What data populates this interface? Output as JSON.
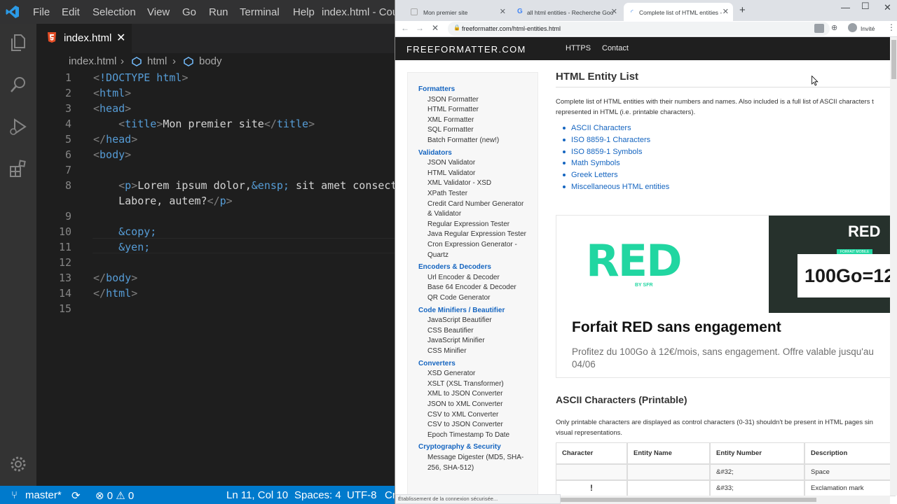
{
  "vscode": {
    "menu": [
      "File",
      "Edit",
      "Selection",
      "View",
      "Go",
      "Run",
      "Terminal",
      "Help"
    ],
    "window_title": "index.html - Cou",
    "tab_label": "index.html",
    "breadcrumb": [
      "index.html",
      "html",
      "body"
    ],
    "lines": [
      {
        "n": "1",
        "code": "<!DOCTYPE html>"
      },
      {
        "n": "2",
        "code": "<html>"
      },
      {
        "n": "3",
        "code": "<head>"
      },
      {
        "n": "4",
        "code": "    <title>Mon premier site</title>"
      },
      {
        "n": "5",
        "code": "</head>"
      },
      {
        "n": "6",
        "code": "<body>"
      },
      {
        "n": "7",
        "code": ""
      },
      {
        "n": "8",
        "code": "    <p>Lorem ipsum dolor,&ensp; sit amet consecte"
      },
      {
        "n": "",
        "code": "    Labore, autem?</p>"
      },
      {
        "n": "9",
        "code": ""
      },
      {
        "n": "10",
        "code": "    &copy;"
      },
      {
        "n": "11",
        "code": "    &yen;"
      },
      {
        "n": "12",
        "code": ""
      },
      {
        "n": "13",
        "code": "</body>"
      },
      {
        "n": "14",
        "code": "</html>"
      },
      {
        "n": "15",
        "code": ""
      }
    ],
    "status": {
      "branch": "master*",
      "problems": "⊗ 0 ⚠ 0",
      "position": "Ln 11, Col 10",
      "spaces": "Spaces: 4",
      "encoding": "UTF-8",
      "trailing": "Cr"
    }
  },
  "chrome": {
    "tabs": [
      {
        "label": "Mon premier site"
      },
      {
        "label": "all html entities - Recherche Goo"
      },
      {
        "label": "Complete list of HTML entities - "
      }
    ],
    "url": "freeformatter.com/html-entities.html",
    "guest": "Invité",
    "status_text": "Établissement de la connexion sécurisée..."
  },
  "site": {
    "logo": "FREEFORMATTER.COM",
    "nav": [
      "HTTPS",
      "Contact"
    ],
    "sidebar": [
      {
        "type": "head",
        "text": "Formatters"
      },
      {
        "type": "link",
        "text": "JSON Formatter"
      },
      {
        "type": "link",
        "text": "HTML Formatter"
      },
      {
        "type": "link",
        "text": "XML Formatter"
      },
      {
        "type": "link",
        "text": "SQL Formatter"
      },
      {
        "type": "link",
        "text": "Batch Formatter (new!)"
      },
      {
        "type": "head",
        "text": "Validators"
      },
      {
        "type": "link",
        "text": "JSON Validator"
      },
      {
        "type": "link",
        "text": "HTML Validator"
      },
      {
        "type": "link",
        "text": "XML Validator - XSD"
      },
      {
        "type": "link",
        "text": "XPath Tester"
      },
      {
        "type": "link",
        "text": "Credit Card Number Generator"
      },
      {
        "type": "link",
        "text": "& Validator"
      },
      {
        "type": "link",
        "text": "Regular Expression Tester"
      },
      {
        "type": "link",
        "text": "Java Regular Expression Tester"
      },
      {
        "type": "link",
        "text": "Cron Expression Generator -"
      },
      {
        "type": "link",
        "text": "Quartz"
      },
      {
        "type": "head",
        "text": "Encoders & Decoders"
      },
      {
        "type": "link",
        "text": "Url Encoder & Decoder"
      },
      {
        "type": "link",
        "text": "Base 64 Encoder & Decoder"
      },
      {
        "type": "link",
        "text": "QR Code Generator"
      },
      {
        "type": "head",
        "text": "Code Minifiers / Beautifier"
      },
      {
        "type": "link",
        "text": "JavaScript Beautifier"
      },
      {
        "type": "link",
        "text": "CSS Beautifier"
      },
      {
        "type": "link",
        "text": "JavaScript Minifier"
      },
      {
        "type": "link",
        "text": "CSS Minifier"
      },
      {
        "type": "head",
        "text": "Converters"
      },
      {
        "type": "link",
        "text": "XSD Generator"
      },
      {
        "type": "link",
        "text": "XSLT (XSL Transformer)"
      },
      {
        "type": "link",
        "text": "XML to JSON Converter"
      },
      {
        "type": "link",
        "text": "JSON to XML Converter"
      },
      {
        "type": "link",
        "text": "CSV to XML Converter"
      },
      {
        "type": "link",
        "text": "CSV to JSON Converter"
      },
      {
        "type": "link",
        "text": "Epoch Timestamp To Date"
      },
      {
        "type": "head",
        "text": "Cryptography & Security"
      },
      {
        "type": "link",
        "text": "Message Digester (MD5, SHA-"
      },
      {
        "type": "link",
        "text": "256, SHA-512)"
      }
    ],
    "title": "HTML Entity List",
    "intro_1": "Complete list of HTML entities with their numbers and names. Also included is a full list of ASCII characters t",
    "intro_2": "represented in HTML (i.e. printable characters).",
    "toc": [
      "ASCII Characters",
      "ISO 8859-1 Characters",
      "ISO 8859-1 Symbols",
      "Math Symbols",
      "Greek Letters",
      "Miscellaneous HTML entities"
    ],
    "ad": {
      "brand": "RED",
      "brand_sub": "BY SFR",
      "badge": "FORFAIT MOBILE",
      "offer": "100Go=12",
      "title": "Forfait RED sans engagement",
      "desc": "Profitez du 100Go à 12€/mois, sans engagement. Offre valable jusqu'au 04/06"
    },
    "ascii_title": "ASCII Characters (Printable)",
    "ascii_desc_1": "Only printable characters are displayed as control characters (0-31) shouldn't be present in HTML pages sin",
    "ascii_desc_2": "visual representations.",
    "table": {
      "headers": [
        "Character",
        "Entity Name",
        "Entity Number",
        "Description"
      ],
      "rows": [
        [
          "",
          "",
          "&#32;",
          "Space"
        ],
        [
          "!",
          "",
          "&#33;",
          "Exclamation mark"
        ]
      ]
    }
  }
}
